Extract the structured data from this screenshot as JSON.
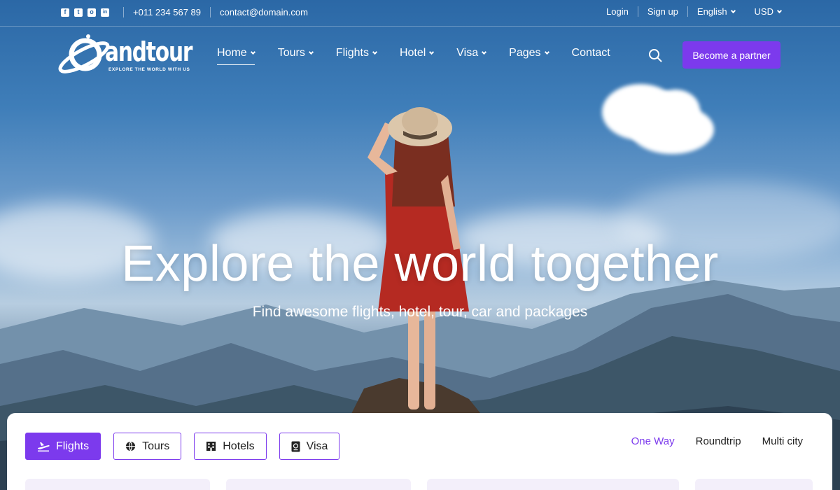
{
  "topbar": {
    "socials": [
      {
        "icon": "facebook-icon",
        "glyph": "f"
      },
      {
        "icon": "twitter-icon",
        "glyph": "t"
      },
      {
        "icon": "instagram-icon",
        "glyph": "o"
      },
      {
        "icon": "linkedin-icon",
        "glyph": "in"
      }
    ],
    "phone": "+011 234 567 89",
    "email": "contact@domain.com",
    "login": "Login",
    "signup": "Sign up",
    "language": "English",
    "currency": "USD"
  },
  "brand": {
    "name": "andtour",
    "tagline": "EXPLORE THE WORLD WITH US"
  },
  "nav": {
    "items": [
      "Home",
      "Tours",
      "Flights",
      "Hotel",
      "Visa",
      "Pages",
      "Contact"
    ],
    "partner_button": "Become a partner"
  },
  "hero": {
    "title": "Explore the world together",
    "subtitle": "Find awesome flights, hotel, tour, car and packages"
  },
  "search": {
    "tabs": [
      {
        "label": "Flights",
        "icon": "plane-icon",
        "active": true
      },
      {
        "label": "Tours",
        "icon": "globe-icon",
        "active": false
      },
      {
        "label": "Hotels",
        "icon": "hotel-icon",
        "active": false
      },
      {
        "label": "Visa",
        "icon": "passport-icon",
        "active": false
      }
    ],
    "trip_types": [
      "One Way",
      "Roundtrip",
      "Multi city"
    ],
    "selected_trip": "One Way"
  },
  "colors": {
    "accent": "#7c3aed",
    "sky": "#2b68a6",
    "panel_field": "#f3effa"
  }
}
